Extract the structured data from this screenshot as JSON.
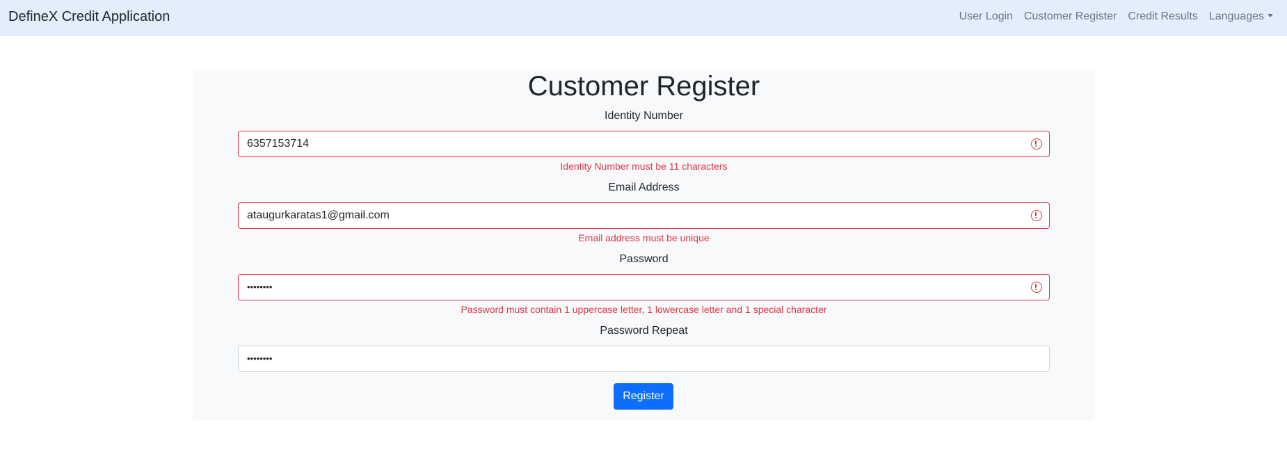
{
  "navbar": {
    "brand": "DefineX Credit Application",
    "links": [
      "User Login",
      "Customer Register",
      "Credit Results"
    ],
    "languages_label": "Languages"
  },
  "form": {
    "title": "Customer Register",
    "identity": {
      "label": "Identity Number",
      "value": "6357153714",
      "error": "Identity Number must be 11 characters"
    },
    "email": {
      "label": "Email Address",
      "value": "ataugurkaratas1@gmail.com",
      "error": "Email address must be unique"
    },
    "password": {
      "label": "Password",
      "value": "••••••••",
      "error": "Password must contain 1 uppercase letter, 1 lowercase letter and 1 special character"
    },
    "password_repeat": {
      "label": "Password Repeat",
      "value": "••••••••"
    },
    "submit_label": "Register"
  },
  "colors": {
    "navbar_bg": "#e2eefb",
    "error": "#dc3545",
    "primary": "#0d6efd",
    "panel_bg": "#f8f9fa"
  }
}
